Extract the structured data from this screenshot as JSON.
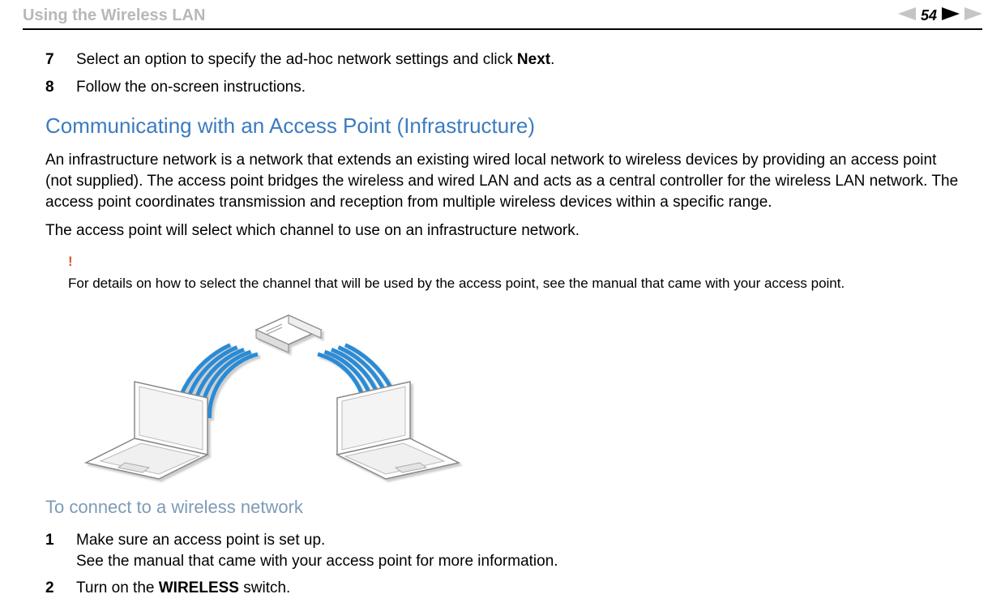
{
  "header": {
    "title": "Using the Wireless LAN",
    "page_number": "54",
    "nav_left_name": "prev-page-icon",
    "nav_right_enabled_name": "next-page-icon",
    "nav_right_disabled_name": "next-page-skip-icon"
  },
  "steps_top": [
    {
      "num": "7",
      "text_before": "Select an option to specify the ad-hoc network settings and click ",
      "bold": "Next",
      "text_after": "."
    },
    {
      "num": "8",
      "text_before": "Follow the on-screen instructions.",
      "bold": "",
      "text_after": ""
    }
  ],
  "section_title": "Communicating with an Access Point (Infrastructure)",
  "paragraph1": "An infrastructure network is a network that extends an existing wired local network to wireless devices by providing an access point (not supplied). The access point bridges the wireless and wired LAN and acts as a central controller for the wireless LAN network. The access point coordinates transmission and reception from multiple wireless devices within a specific range.",
  "paragraph2": "The access point will select which channel to use on an infrastructure network.",
  "warning": {
    "mark": "!",
    "text": "For details on how to select the channel that will be used by the access point, see the manual that came with your access point."
  },
  "sub_heading": "To connect to a wireless network",
  "steps_bottom": [
    {
      "num": "1",
      "line1": "Make sure an access point is set up.",
      "line2": "See the manual that came with your access point for more information."
    },
    {
      "num": "2",
      "text_before": "Turn on the ",
      "bold": "WIRELESS",
      "text_after": " switch."
    }
  ]
}
